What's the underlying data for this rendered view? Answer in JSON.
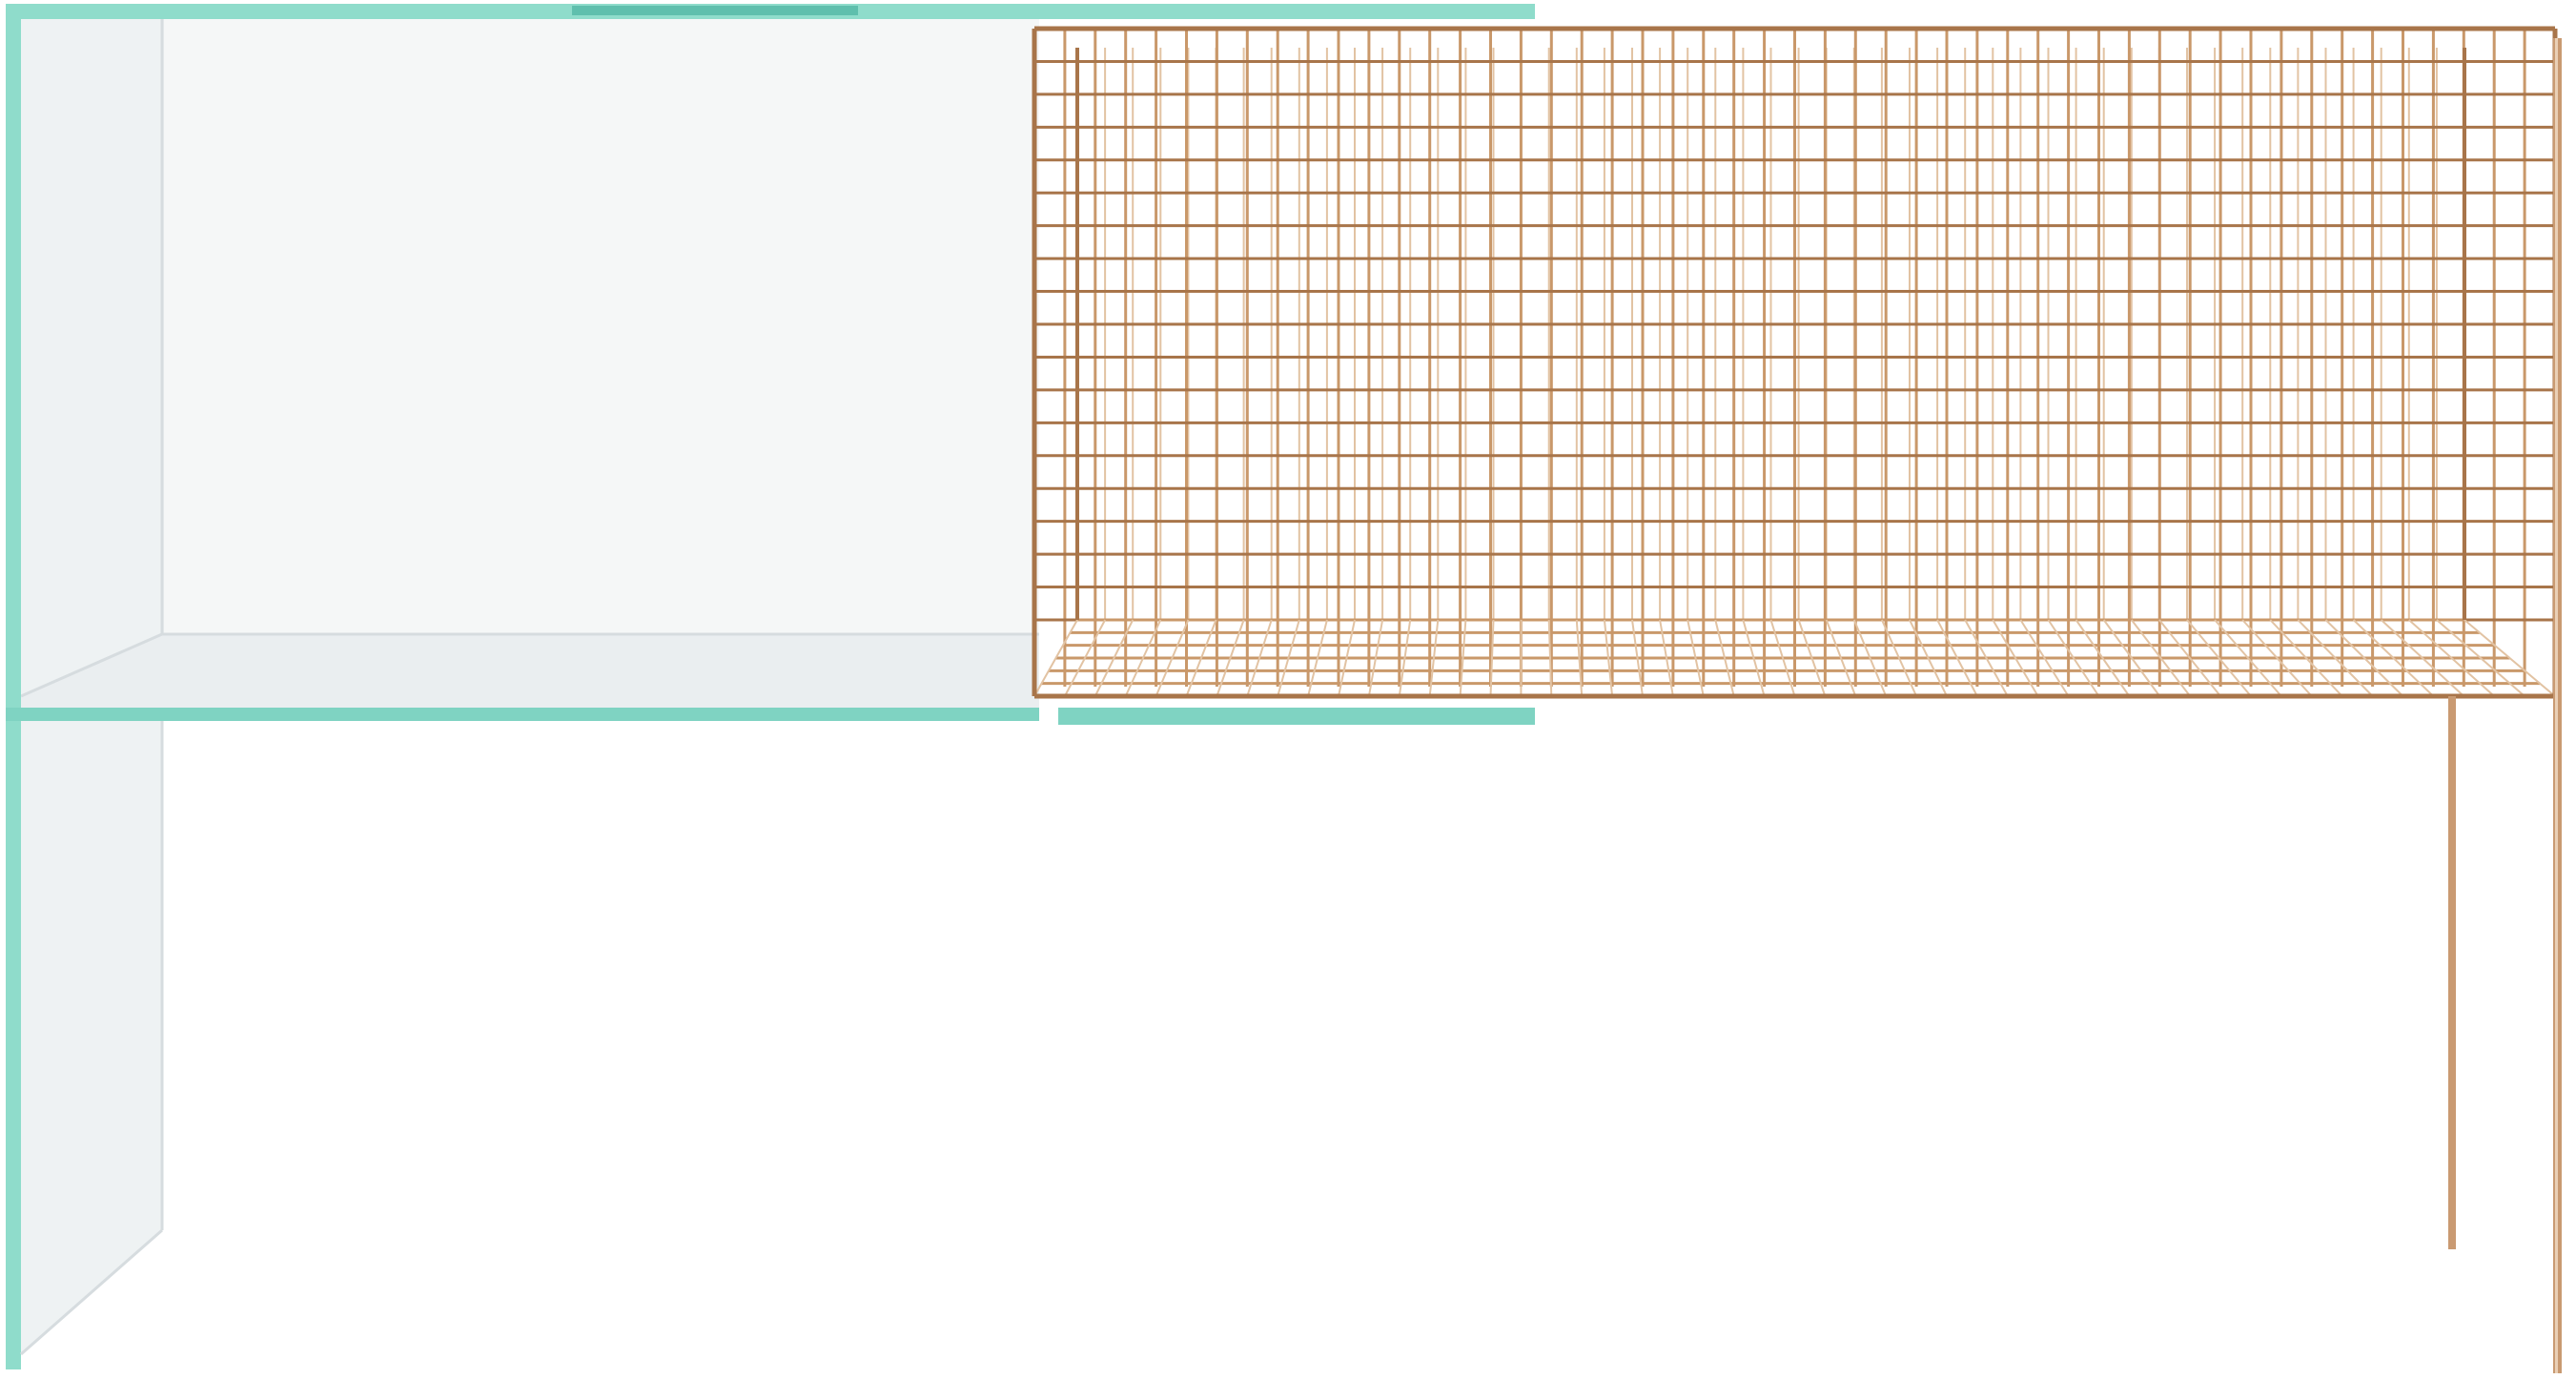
{
  "image": {
    "subject": "console-table",
    "background_color": "#ffffff"
  },
  "glass_unit": {
    "material": "glass",
    "edge_color": "#7fd3c2",
    "edge_color_dark": "#5fbfad",
    "panel_tint": "#eef1f2",
    "panel_tint_light": "#f6f8f8"
  },
  "wire_basket": {
    "material": "copper-wire",
    "wire_color": "#c9986a",
    "wire_color_light": "#e2c3a3",
    "wire_color_dark": "#a8754a",
    "vertical_wire_count": 50,
    "horizontal_wire_count": 18,
    "floor_wire_count": 6
  },
  "legs": {
    "material": "copper",
    "color": "#c99a72",
    "highlight": "#ead0b6"
  }
}
